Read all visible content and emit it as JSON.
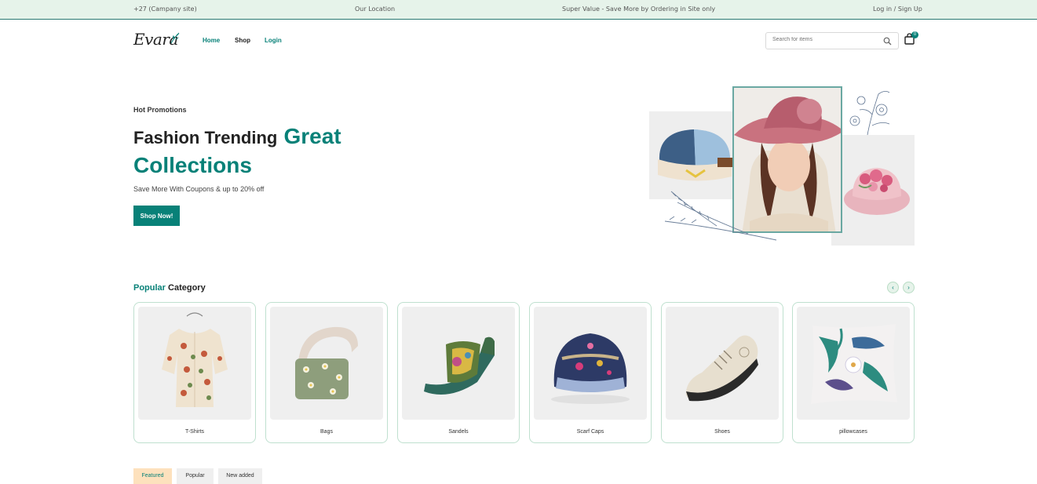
{
  "topbar": {
    "phone": "+27 (Campany site)",
    "location": "Our Location",
    "promo": "Super Value - Save More by Ordering in Site only",
    "auth": "Log in / Sign Up"
  },
  "header": {
    "logo": "Evara",
    "nav": [
      {
        "label": "Home",
        "color": "#088178"
      },
      {
        "label": "Shop",
        "color": "#222222"
      },
      {
        "label": "Login",
        "color": "#088178"
      }
    ],
    "search_placeholder": "Search for items",
    "cart_count": "0"
  },
  "hero": {
    "subtitle": "Hot Promotions",
    "title_part1": "Fashion Trending",
    "title_accent": "Great",
    "title_line2": "Collections",
    "description": "Save More With Coupons & up to 20% off",
    "button": "Shop Now!"
  },
  "categories": {
    "heading_accent": "Popular",
    "heading": "Category",
    "items": [
      {
        "label": "T-Shirts",
        "icon": "shirt-icon"
      },
      {
        "label": "Bags",
        "icon": "bag-icon"
      },
      {
        "label": "Sandels",
        "icon": "sandal-icon"
      },
      {
        "label": "Scarf Caps",
        "icon": "cap-icon"
      },
      {
        "label": "Shoes",
        "icon": "shoe-icon"
      },
      {
        "label": "pillowcases",
        "icon": "pillow-icon"
      }
    ]
  },
  "tabs": [
    {
      "label": "Featured",
      "active": true
    },
    {
      "label": "Popular",
      "active": false
    },
    {
      "label": "New added",
      "active": false
    }
  ],
  "colors": {
    "accent": "#088178",
    "topbar_bg": "#e6f3ea",
    "tab_active_bg": "#fde1bd"
  }
}
